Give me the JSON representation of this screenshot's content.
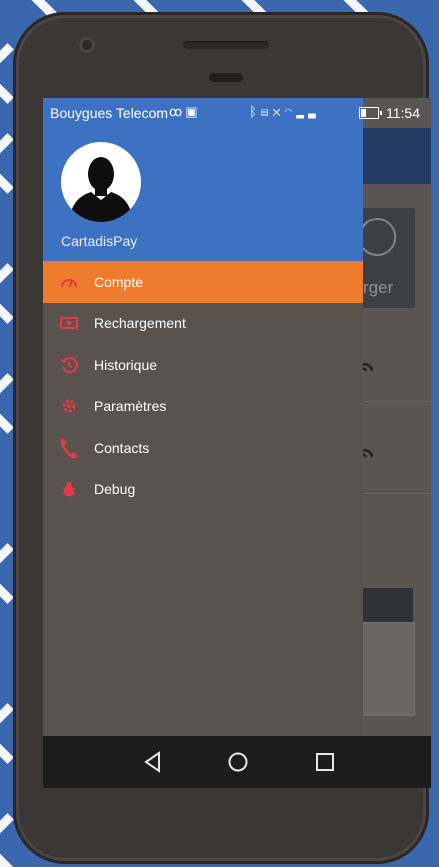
{
  "status_bar": {
    "carrier": "Bouygues Telecom",
    "time": "11:54",
    "icons": [
      "voicemail-icon",
      "image-icon",
      "bluetooth-icon",
      "nfc-icon",
      "mute-icon",
      "wifi-icon",
      "signal-icon",
      "battery-icon"
    ]
  },
  "drawer": {
    "username": "CartadisPay",
    "items": [
      {
        "label": "Compte",
        "icon": "speedometer-icon",
        "active": true
      },
      {
        "label": "Rechargement",
        "icon": "cash-icon",
        "active": false
      },
      {
        "label": "Historique",
        "icon": "history-icon",
        "active": false
      },
      {
        "label": "Paramètres",
        "icon": "gear-icon",
        "active": false
      },
      {
        "label": "Contacts",
        "icon": "phone-icon",
        "active": false
      },
      {
        "label": "Debug",
        "icon": "bug-icon",
        "active": false
      }
    ]
  },
  "background_app": {
    "card_label": "rger"
  },
  "colors": {
    "drawer_header": "#3c72c1",
    "active_item": "#ef7b2d",
    "menu_icon": "#e8394a",
    "drawer_bg": "#5a524f",
    "page_bg": "#3a67ad"
  },
  "nav_bar": {
    "buttons": [
      "back-icon",
      "home-icon",
      "recents-icon"
    ]
  }
}
